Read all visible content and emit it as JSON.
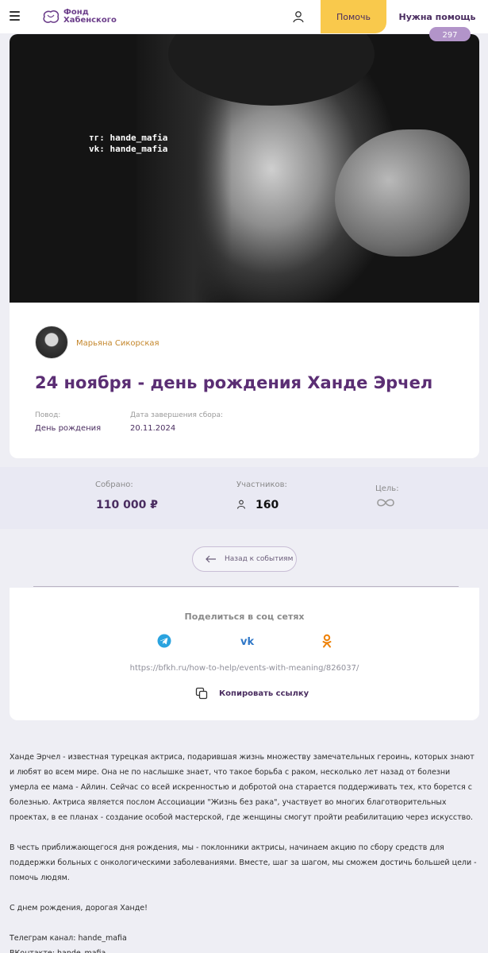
{
  "header": {
    "logo_line1": "Фонд",
    "logo_line2": "Хабенского",
    "help_label": "Помочь",
    "need_help_label": "Нужна помощь"
  },
  "photo": {
    "caption_line1": "тг: hande_mafia",
    "caption_line2": "vk: hande_mafia",
    "badge": "297"
  },
  "event": {
    "author": "Марьяна Сикорская",
    "title": "24 ноября - день рождения Ханде Эрчел",
    "reason_label": "Повод:",
    "reason_value": "День рождения",
    "end_label": "Дата завершения сбора:",
    "end_value": "20.11.2024"
  },
  "stats": {
    "collected_label": "Собрано:",
    "collected_value": "110 000 ₽",
    "participants_label": "Участников:",
    "participants_value": "160",
    "goal_label": "Цель:"
  },
  "back_label": "Назад к событиям",
  "share": {
    "title": "Поделиться в соц сетях",
    "url": "https://bfkh.ru/how-to-help/events-with-meaning/826037/",
    "copy_label": "Копировать ссылку"
  },
  "description": {
    "p1": "Ханде Эрчел - известная турецкая актриса, подарившая жизнь множеству замечательных героинь, которых знают и любят во всем мире. Она не по наслышке знает, что такое борьба с раком, несколько лет назад от болезни умерла ее мама - Айлин. Сейчас со всей искренностью и добротой она старается поддерживать тех, кто борется с болезнью. Актриса является послом Ассоциации \"Жизнь без рака\", участвует во многих благотворительных проектах, в ее планах - создание особой мастерской, где женщины смогут пройти реабилитацию через искусство.",
    "p2": "В честь приближающегося дня рождения, мы - поклонники актрисы, начинаем акцию по сбору средств для поддержки больных с онкологическими заболеваниями. Вместе, шаг за шагом, мы сможем достичь большей цели - помочь людям.",
    "p3": "С днем рождения, дорогая Ханде!",
    "p4": "Телеграм канал: hande_mafia",
    "p5": "ВКонтакте: hande_mafia"
  },
  "colors": {
    "accent_yellow": "#f9c94c",
    "brand_purple": "#5b2e74",
    "author_orange": "#c4862a",
    "telegram": "#2aa3df",
    "vk": "#2f77c7",
    "ok": "#ee8208"
  },
  "icons": [
    "menu-icon",
    "logo-icon",
    "user-icon",
    "person-icon",
    "infinity-icon",
    "arrow-left-icon",
    "telegram-icon",
    "vk-icon",
    "odnoklassniki-icon",
    "copy-icon"
  ]
}
